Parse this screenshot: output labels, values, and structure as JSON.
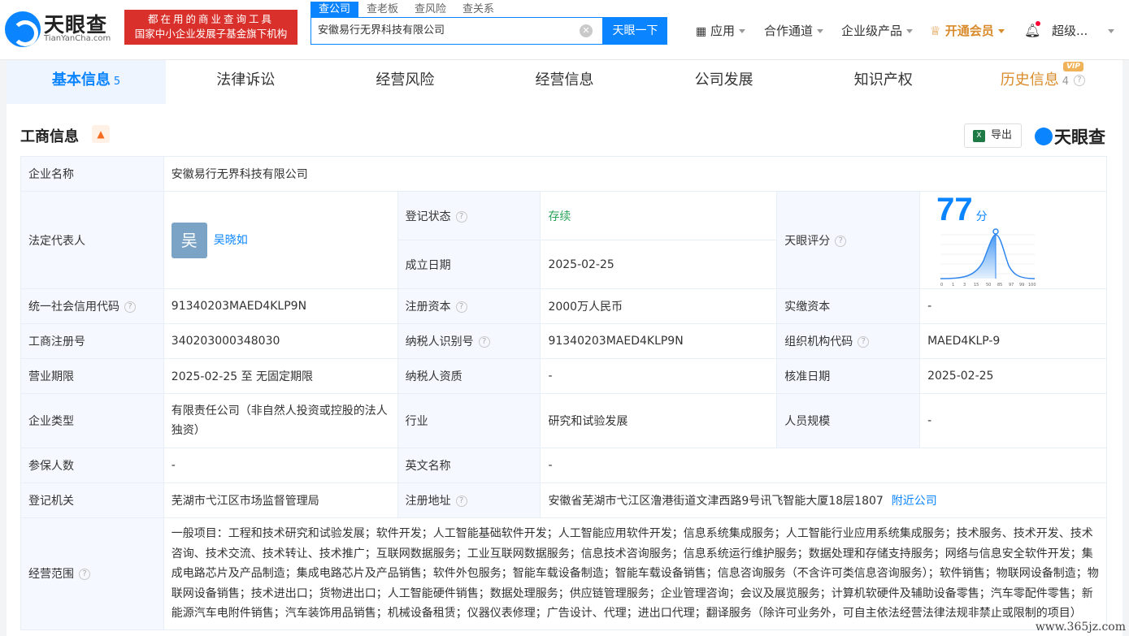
{
  "header": {
    "logo_text": "天眼查",
    "logo_sub": "TianYanCha.com",
    "promo_line1": "都在用的商业查询工具",
    "promo_line2": "国家中小企业发展子基金旗下机构",
    "search_tabs": [
      "查公司",
      "查老板",
      "查风险",
      "查关系"
    ],
    "search_value": "安徽易行无界科技有限公司",
    "search_button": "天眼一下",
    "nav_apps": "应用",
    "nav_partner": "合作通道",
    "nav_enterprise": "企业级产品",
    "nav_vip": "开通会员",
    "nav_user": "超级..."
  },
  "tabs": [
    {
      "label": "基本信息",
      "count": "5"
    },
    {
      "label": "法律诉讼",
      "count": ""
    },
    {
      "label": "经营风险",
      "count": ""
    },
    {
      "label": "经营信息",
      "count": ""
    },
    {
      "label": "公司发展",
      "count": ""
    },
    {
      "label": "知识产权",
      "count": ""
    },
    {
      "label": "历史信息",
      "count": "4",
      "badge": "VIP"
    }
  ],
  "section": {
    "title": "工商信息",
    "export_label": "导出",
    "brand": "天眼查"
  },
  "info": {
    "company_name_label": "企业名称",
    "company_name": "安徽易行无界科技有限公司",
    "legal_rep_label": "法定代表人",
    "legal_rep_avatar": "吴",
    "legal_rep": "吴晓如",
    "reg_status_label": "登记状态",
    "reg_status": "存续",
    "found_date_label": "成立日期",
    "found_date": "2025-02-25",
    "score_label": "天眼评分",
    "score": "77",
    "score_unit": "分",
    "score_ticks": [
      "0",
      "1",
      "3",
      "15",
      "50",
      "85",
      "97",
      "99",
      "100"
    ],
    "credit_code_label": "统一社会信用代码",
    "credit_code": "91340203MAED4KLP9N",
    "reg_capital_label": "注册资本",
    "reg_capital": "2000万人民币",
    "paid_capital_label": "实缴资本",
    "paid_capital": "-",
    "reg_no_label": "工商注册号",
    "reg_no": "340203000348030",
    "taxpayer_id_label": "纳税人识别号",
    "taxpayer_id": "91340203MAED4KLP9N",
    "org_code_label": "组织机构代码",
    "org_code": "MAED4KLP-9",
    "term_label": "营业期限",
    "term": "2025-02-25 至 无固定期限",
    "taxpayer_qual_label": "纳税人资质",
    "taxpayer_qual": "-",
    "approve_date_label": "核准日期",
    "approve_date": "2025-02-25",
    "company_type_label": "企业类型",
    "company_type": "有限责任公司（非自然人投资或控股的法人独资）",
    "industry_label": "行业",
    "industry": "研究和试验发展",
    "staff_size_label": "人员规模",
    "staff_size": "-",
    "insured_label": "参保人数",
    "insured": "-",
    "english_name_label": "英文名称",
    "english_name": "-",
    "authority_label": "登记机关",
    "authority": "芜湖市弋江区市场监督管理局",
    "address_label": "注册地址",
    "address": "安徽省芜湖市弋江区澛港街道文津西路9号讯飞智能大厦18层1807",
    "nearby": "附近公司",
    "scope_label": "经营范围",
    "scope": "一般项目：工程和技术研究和试验发展；软件开发；人工智能基础软件开发；人工智能应用软件开发；信息系统集成服务；人工智能行业应用系统集成服务；技术服务、技术开发、技术咨询、技术交流、技术转让、技术推广；互联网数据服务；工业互联网数据服务；信息技术咨询服务；信息系统运行维护服务；数据处理和存储支持服务；网络与信息安全软件开发；集成电路芯片及产品制造；集成电路芯片及产品销售；软件外包服务；智能车载设备制造；智能车载设备销售；信息咨询服务（不含许可类信息咨询服务）；软件销售；物联网设备制造；物联网设备销售；技术进出口；货物进出口；人工智能硬件销售；数据处理服务；供应链管理服务；企业管理咨询；会议及展览服务；计算机软硬件及辅助设备零售；汽车零配件零售；新能源汽车电附件销售；汽车装饰用品销售；机械设备租赁；仪器仪表修理；广告设计、代理；进出口代理；翻译服务（除许可业务外，可自主依法经营法律法规非禁止或限制的项目）"
  },
  "watermark": "www.365jz.com",
  "colors": {
    "accent": "#0a84ff",
    "promo": "#d9302b",
    "status_green": "#2aa35a",
    "vip": "#d98b2b"
  }
}
